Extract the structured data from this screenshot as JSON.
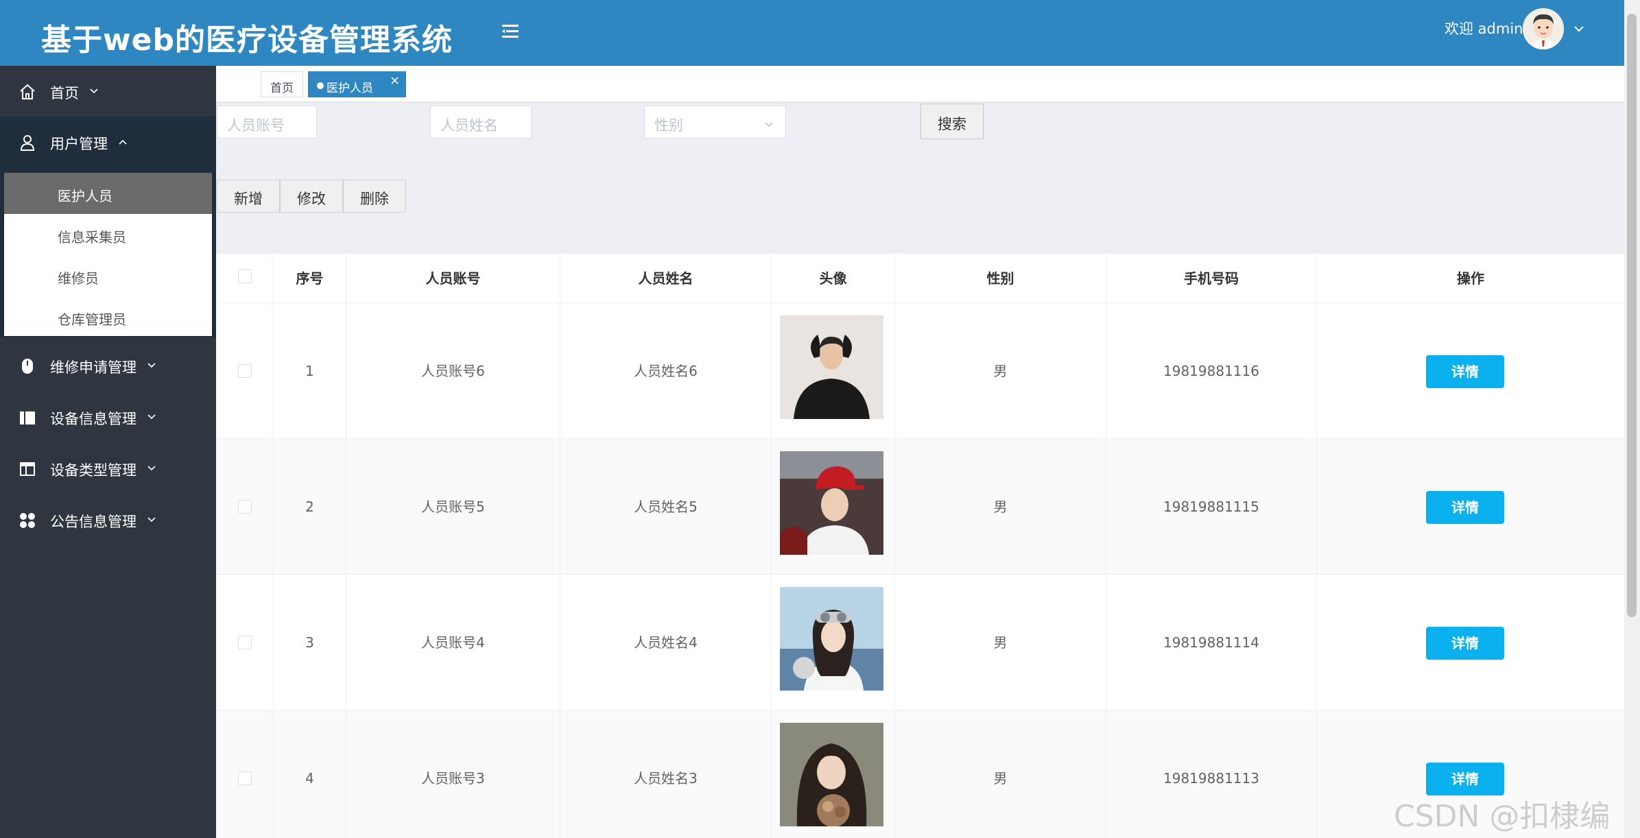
{
  "header": {
    "title": "基于web的医疗设备管理系统",
    "welcome": "欢迎 admin"
  },
  "sidebar": {
    "items": [
      {
        "label": "首页",
        "icon": "home-icon"
      },
      {
        "label": "用户管理",
        "icon": "user-icon"
      },
      {
        "label": "维修申请管理",
        "icon": "repair-icon"
      },
      {
        "label": "设备信息管理",
        "icon": "book-icon"
      },
      {
        "label": "设备类型管理",
        "icon": "layout-icon"
      },
      {
        "label": "公告信息管理",
        "icon": "apps-icon"
      }
    ],
    "submenu": [
      {
        "label": "医护人员",
        "active": true
      },
      {
        "label": "信息采集员"
      },
      {
        "label": "维修员"
      },
      {
        "label": "仓库管理员"
      }
    ]
  },
  "tabs": {
    "home": "首页",
    "active": "医护人员",
    "close": "×"
  },
  "search": {
    "account_placeholder": "人员账号",
    "name_placeholder": "人员姓名",
    "gender_placeholder": "性别",
    "search_label": "搜索"
  },
  "actions": {
    "add": "新增",
    "edit": "修改",
    "delete": "删除"
  },
  "table": {
    "headers": [
      "序号",
      "人员账号",
      "人员姓名",
      "头像",
      "性别",
      "手机号码",
      "操作"
    ],
    "rows": [
      {
        "index": "1",
        "account": "人员账号6",
        "name": "人员姓名6",
        "gender": "男",
        "phone": "19819881116",
        "action": "详情"
      },
      {
        "index": "2",
        "account": "人员账号5",
        "name": "人员姓名5",
        "gender": "男",
        "phone": "19819881115",
        "action": "详情"
      },
      {
        "index": "3",
        "account": "人员账号4",
        "name": "人员姓名4",
        "gender": "男",
        "phone": "19819881114",
        "action": "详情"
      },
      {
        "index": "4",
        "account": "人员账号3",
        "name": "人员姓名3",
        "gender": "男",
        "phone": "19819881113",
        "action": "详情"
      }
    ]
  },
  "watermark": "CSDN @扣棣编程",
  "colors": {
    "header": "#2f87c1",
    "sidebar": "#2f3640",
    "detail_button": "#0bb0ee",
    "search_area": "#edeff5"
  }
}
